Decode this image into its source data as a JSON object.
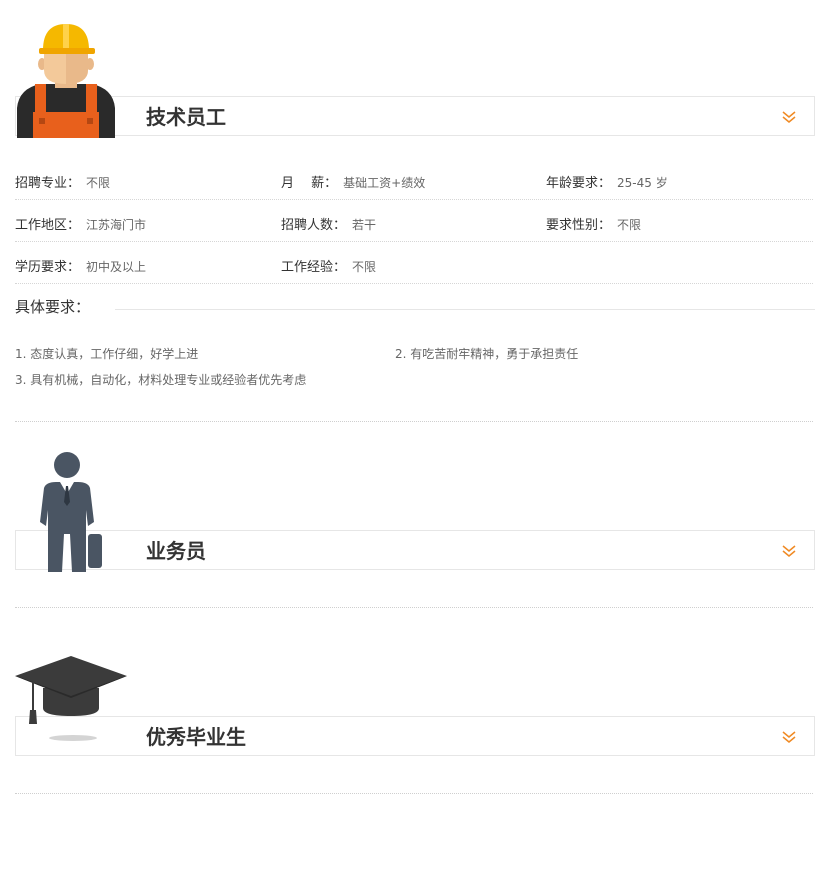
{
  "jobs": [
    {
      "title": "技术员工",
      "icon": "worker-hardhat-icon",
      "details": {
        "major": {
          "label": "招聘专业：",
          "value": "不限"
        },
        "salary": {
          "label": "月　 薪：",
          "value": "基础工资+绩效"
        },
        "age": {
          "label": "年龄要求：",
          "value": "25-45 岁"
        },
        "location": {
          "label": "工作地区：",
          "value": "江苏海门市"
        },
        "headcount": {
          "label": "招聘人数：",
          "value": "若干"
        },
        "gender": {
          "label": "要求性别：",
          "value": "不限"
        },
        "education": {
          "label": "学历要求：",
          "value": "初中及以上"
        },
        "experience": {
          "label": "工作经验：",
          "value": "不限"
        }
      },
      "requirements_title": "具体要求：",
      "requirements": [
        "1. 态度认真，工作仔细，好学上进",
        "2. 有吃苦耐牢精神，勇于承担责任",
        "3. 具有机械，自动化，材料处理专业或经验者优先考虑"
      ]
    },
    {
      "title": "业务员",
      "icon": "businessman-icon"
    },
    {
      "title": "优秀毕业生",
      "icon": "graduation-cap-icon"
    }
  ],
  "colors": {
    "accent": "#f08a24",
    "hardhat": "#f5b800",
    "vest": "#e8601c",
    "suit": "#4a5563",
    "cap": "#3b3b3b"
  }
}
